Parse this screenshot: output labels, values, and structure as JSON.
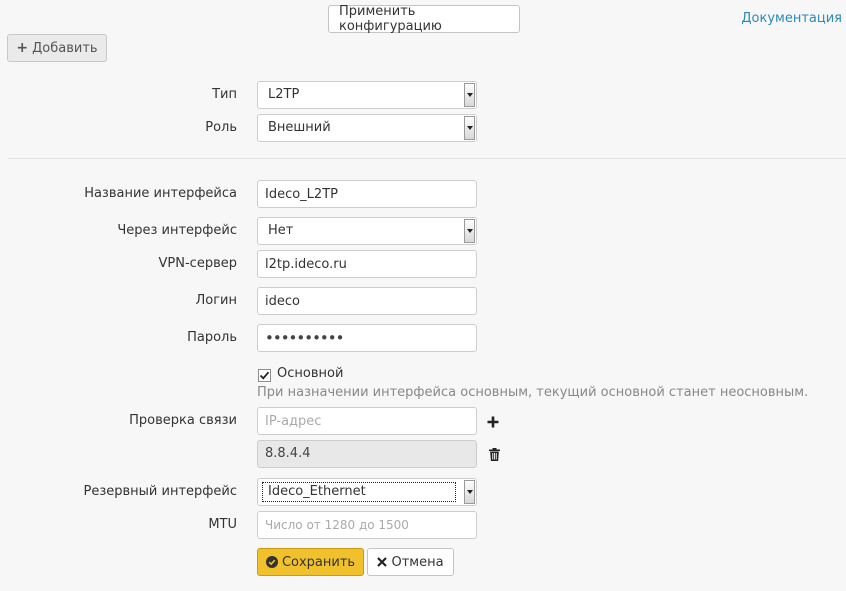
{
  "toolbar": {
    "apply_label": "Применить конфигурацию",
    "docs_label": "Документация",
    "add_label": "Добавить"
  },
  "form": {
    "type": {
      "label": "Тип",
      "value": "L2TP"
    },
    "role": {
      "label": "Роль",
      "value": "Внешний"
    },
    "iface_name": {
      "label": "Название интерфейса",
      "value": "Ideco_L2TP"
    },
    "via_iface": {
      "label": "Через интерфейс",
      "value": "Нет"
    },
    "vpn_server": {
      "label": "VPN-сервер",
      "value": "l2tp.ideco.ru"
    },
    "login": {
      "label": "Логин",
      "value": "ideco"
    },
    "password": {
      "label": "Пароль",
      "value": "••••••••••"
    },
    "primary": {
      "label": "Основной",
      "checked": true,
      "hint": "При назначении интерфейса основным, текущий основной станет неосновным."
    },
    "link_check": {
      "label": "Проверка связи",
      "placeholder": "IP-адрес",
      "entries": [
        "8.8.4.4"
      ]
    },
    "backup_iface": {
      "label": "Резервный интерфейс",
      "value": "Ideco_Ethernet"
    },
    "mtu": {
      "label": "MTU",
      "placeholder": "Число от 1280 до 1500"
    }
  },
  "actions": {
    "save_label": "Сохранить",
    "cancel_label": "Отмена"
  },
  "colors": {
    "accent": "#f0c12b",
    "link": "#2a8ab5"
  },
  "icons": [
    "plus-icon",
    "add-ip-icon",
    "trash-icon",
    "checkmark-circle-icon",
    "close-icon",
    "chevron-down-icon"
  ]
}
